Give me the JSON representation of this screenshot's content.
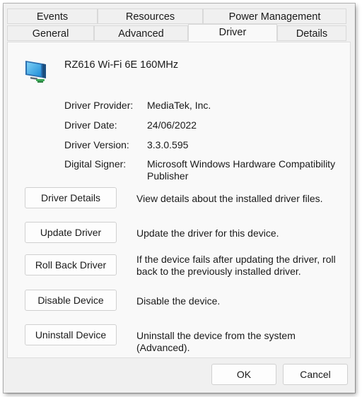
{
  "tabs_row1": [
    {
      "label": "Events"
    },
    {
      "label": "Resources"
    },
    {
      "label": "Power Management"
    }
  ],
  "tabs_row2": [
    {
      "label": "General"
    },
    {
      "label": "Advanced"
    },
    {
      "label": "Driver",
      "active": true
    },
    {
      "label": "Details"
    }
  ],
  "device": {
    "name": "RZ616 Wi-Fi 6E 160MHz",
    "icon": "network-adapter-icon"
  },
  "info": [
    {
      "label": "Driver Provider:",
      "value": "MediaTek, Inc."
    },
    {
      "label": "Driver Date:",
      "value": "24/06/2022"
    },
    {
      "label": "Driver Version:",
      "value": "3.3.0.595"
    },
    {
      "label": "Digital Signer:",
      "value": "Microsoft Windows Hardware Compatibility Publisher"
    }
  ],
  "actions": [
    {
      "button": "Driver Details",
      "description": "View details about the installed driver files."
    },
    {
      "button": "Update Driver",
      "description": "Update the driver for this device."
    },
    {
      "button": "Roll Back Driver",
      "description": "If the device fails after updating the driver, roll back to the previously installed driver."
    },
    {
      "button": "Disable Device",
      "description": "Disable the device."
    },
    {
      "button": "Uninstall Device",
      "description": "Uninstall the device from the system (Advanced)."
    }
  ],
  "footer": {
    "ok_label": "OK",
    "cancel_label": "Cancel"
  }
}
